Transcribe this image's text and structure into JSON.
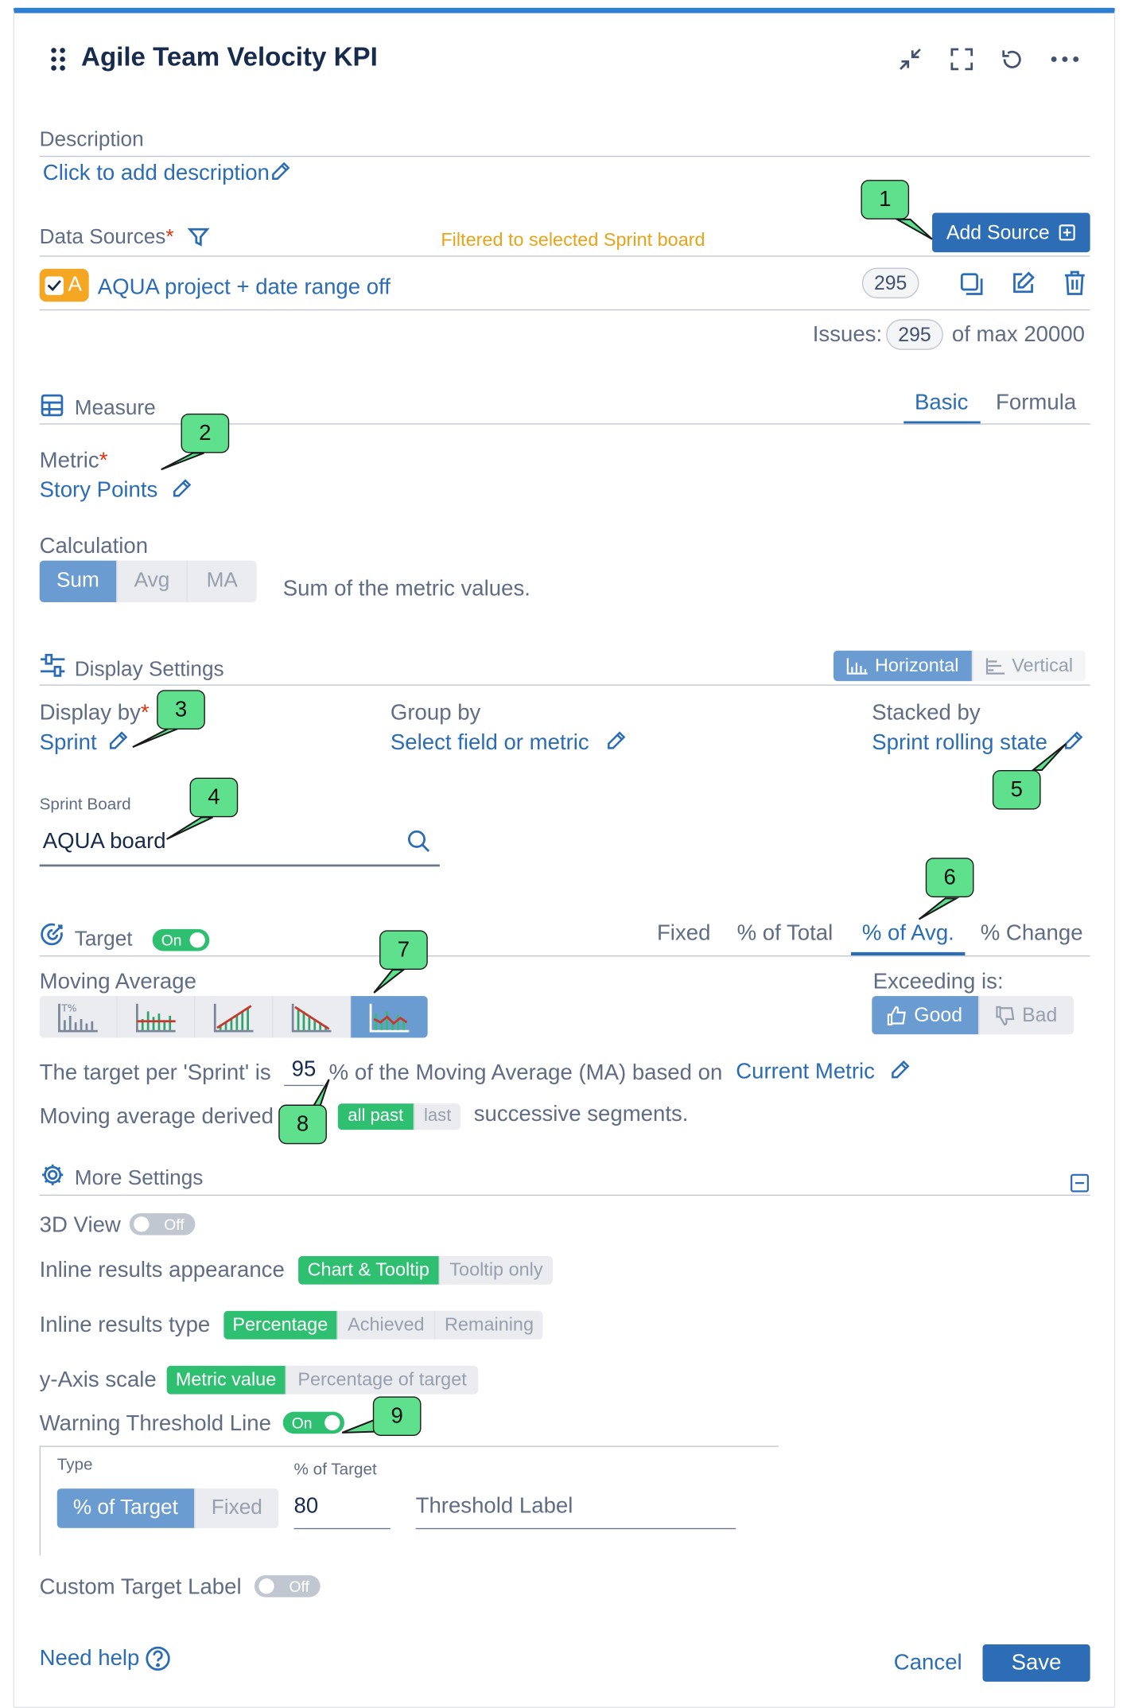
{
  "header": {
    "title": "Agile Team Velocity KPI"
  },
  "description": {
    "label": "Description",
    "placeholder_link": "Click to add description"
  },
  "data_sources": {
    "label": "Data Sources",
    "required_mark": "*",
    "filter_note": "Filtered to selected Sprint board",
    "add_button": "Add Source",
    "source": {
      "badge": "A",
      "name": "AQUA project + date range off",
      "count": "295"
    },
    "issues": {
      "label": "Issues:",
      "count": "295",
      "max_text": "of max 20000"
    }
  },
  "measure": {
    "title": "Measure",
    "tabs": [
      "Basic",
      "Formula"
    ],
    "metric_label": "Metric",
    "metric_value": "Story Points",
    "calculation_label": "Calculation",
    "calculation_options": [
      "Sum",
      "Avg",
      "MA"
    ],
    "calculation_note": "Sum of the metric values."
  },
  "display_settings": {
    "title": "Display Settings",
    "orientation": [
      "Horizontal",
      "Vertical"
    ],
    "display_by_label": "Display by",
    "display_by_value": "Sprint",
    "group_by_label": "Group by",
    "group_by_value": "Select field or metric",
    "stacked_by_label": "Stacked by",
    "stacked_by_value": "Sprint rolling state",
    "sprint_board_label": "Sprint Board",
    "sprint_board_value": "AQUA board"
  },
  "target": {
    "title": "Target",
    "toggle": "On",
    "tabs": [
      "Fixed",
      "% of Total",
      "% of Avg.",
      "% Change"
    ],
    "moving_average_label": "Moving Average",
    "exceeding_label": "Exceeding is:",
    "exceeding_options": [
      "Good",
      "Bad"
    ],
    "sentence_prefix": "The target per 'Sprint' is",
    "percent_value": "95",
    "sentence_suffix": "% of the Moving Average (MA) based on",
    "metric_link": "Current Metric",
    "derived_label": "Moving average derived",
    "derived_options": [
      "all past",
      "last"
    ],
    "derived_suffix": "successive segments."
  },
  "more_settings": {
    "title": "More Settings",
    "view_3d_label": "3D View",
    "view_3d_toggle": "Off",
    "inline_appearance_label": "Inline results appearance",
    "inline_appearance_options": [
      "Chart & Tooltip",
      "Tooltip only"
    ],
    "inline_type_label": "Inline results type",
    "inline_type_options": [
      "Percentage",
      "Achieved",
      "Remaining"
    ],
    "y_axis_label": "y-Axis scale",
    "y_axis_options": [
      "Metric value",
      "Percentage of target"
    ],
    "warning_label": "Warning Threshold Line",
    "warning_toggle": "On",
    "threshold": {
      "type_label": "Type",
      "type_options": [
        "% of Target",
        "Fixed"
      ],
      "percent_label": "% of Target",
      "percent_value": "80",
      "label_placeholder": "Threshold Label"
    },
    "custom_label": "Custom Target Label",
    "custom_toggle": "Off"
  },
  "footer": {
    "help": "Need help",
    "cancel": "Cancel",
    "save": "Save"
  },
  "callouts": [
    "1",
    "2",
    "3",
    "4",
    "5",
    "6",
    "7",
    "8",
    "9"
  ],
  "colors": {
    "accent": "#2a6cb5",
    "primary_button": "#2d6db5",
    "toggle_on": "#2fbf71",
    "callout": "#5fe08d",
    "source_badge": "#f5a623",
    "warning_note": "#e8a317"
  }
}
